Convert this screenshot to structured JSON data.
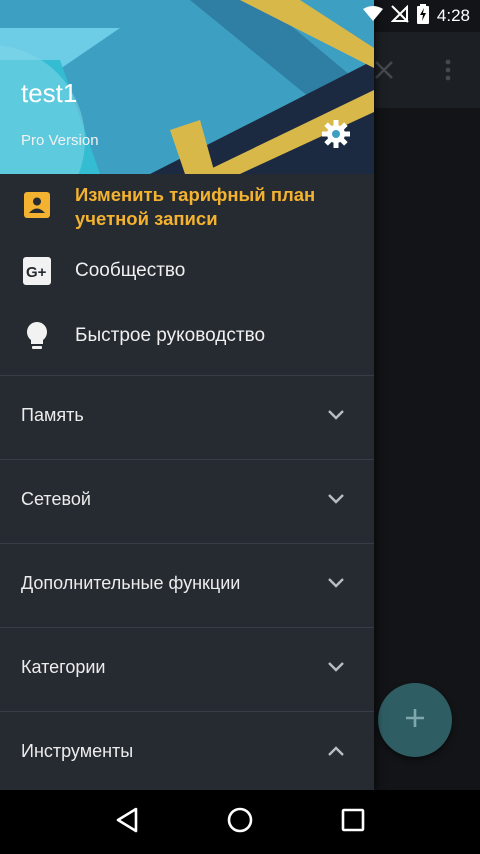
{
  "status_bar": {
    "time": "4:28",
    "icons": [
      "wifi-icon",
      "no-signal-icon",
      "battery-charging-icon"
    ]
  },
  "background_app": {
    "actions": [
      "close-icon",
      "more-vert-icon"
    ],
    "fab_icon": "plus-icon"
  },
  "drawer": {
    "header": {
      "username": "test1",
      "subtitle": "Pro Version",
      "settings_icon": "gear-icon"
    },
    "items": [
      {
        "label": "Изменить тарифный план учетной записи",
        "icon": "account-box-icon",
        "highlight_color": "#f3b22f"
      },
      {
        "label": "Сообщество",
        "icon": "google-plus-icon"
      },
      {
        "label": "Быстрое руководство",
        "icon": "lightbulb-icon"
      }
    ],
    "sections": [
      {
        "label": "Память",
        "expanded": false
      },
      {
        "label": "Сетевой",
        "expanded": false
      },
      {
        "label": "Дополнительные функции",
        "expanded": false
      },
      {
        "label": "Категории",
        "expanded": false
      },
      {
        "label": "Инструменты",
        "expanded": true
      }
    ]
  },
  "nav_bar": {
    "buttons": [
      "back-icon",
      "home-icon",
      "recents-icon"
    ]
  },
  "colors": {
    "drawer_bg": "#262a31",
    "accent": "#f3b22f",
    "header_blue": "#5bbfd9"
  }
}
